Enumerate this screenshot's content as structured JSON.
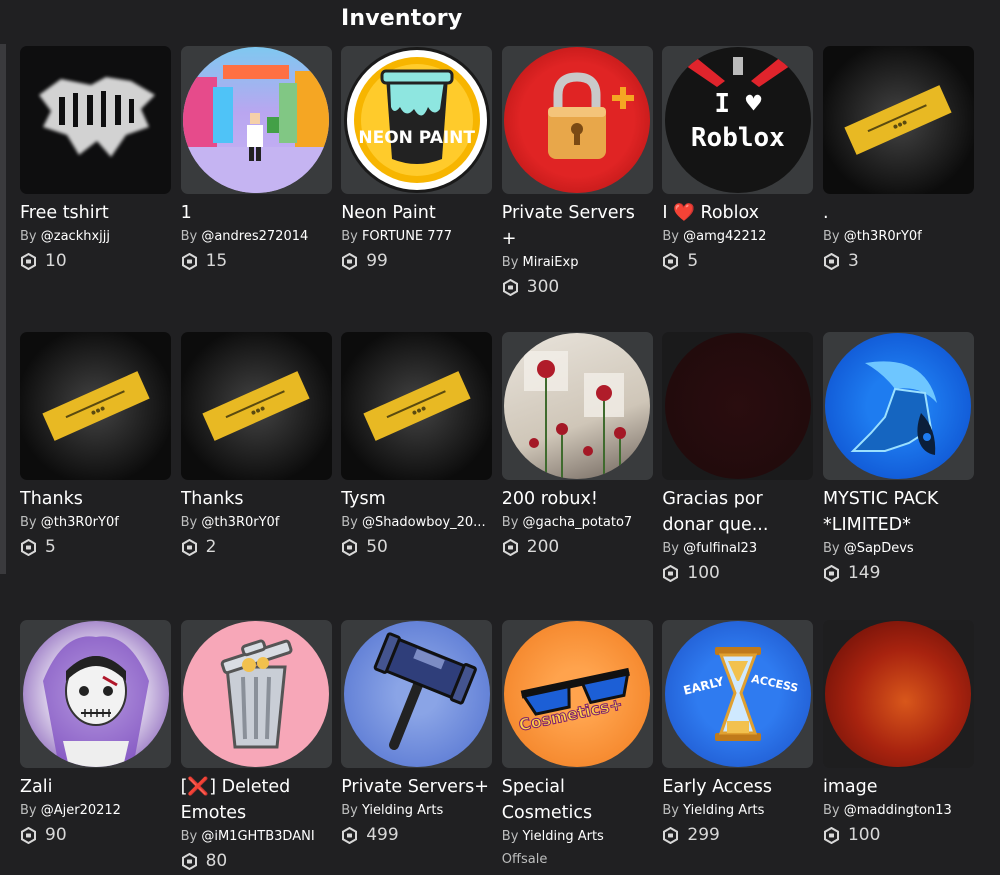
{
  "page": {
    "title": "Inventory"
  },
  "by_prefix": "By ",
  "items": [
    {
      "name": "Free tshirt",
      "creator": "@zackhxjjj",
      "price": "10"
    },
    {
      "name": "1",
      "creator": "@andres272014",
      "price": "15"
    },
    {
      "name": "Neon Paint",
      "creator": "FORTUNE 777",
      "price": "99",
      "thumb_text": "NEON PAINT"
    },
    {
      "name": "Private Servers +",
      "creator": "MiraiExp",
      "price": "300"
    },
    {
      "name": "I ❤️ Roblox",
      "creator": "@amg42212",
      "price": "5",
      "thumb_text_1": "I ♥",
      "thumb_text_2": "Roblox"
    },
    {
      "name": ".",
      "creator": "@th3R0rY0f",
      "price": "3"
    },
    {
      "name": "Thanks",
      "creator": "@th3R0rY0f",
      "price": "5"
    },
    {
      "name": "Thanks",
      "creator": "@th3R0rY0f",
      "price": "2"
    },
    {
      "name": "Tysm",
      "creator": "@Shadowboy_20...",
      "price": "50"
    },
    {
      "name": "200 robux!",
      "creator": "@gacha_potato7",
      "price": "200"
    },
    {
      "name": "Gracias por donar que...",
      "creator": "@fulfinal23",
      "price": "100"
    },
    {
      "name": "MYSTIC PACK *LIMITED*",
      "creator": "@SapDevs",
      "price": "149"
    },
    {
      "name": "Zali",
      "creator": "@Ajer20212",
      "price": "90"
    },
    {
      "name": "[❌] Deleted Emotes",
      "creator": "@iM1GHTB3DANI",
      "price": "80"
    },
    {
      "name": "Private Servers+",
      "creator": "Yielding Arts",
      "price": "499"
    },
    {
      "name": "Special Cosmetics",
      "creator": "Yielding Arts",
      "status": "Offsale",
      "thumb_text": "Cosmetics+"
    },
    {
      "name": "Early Access",
      "creator": "Yielding Arts",
      "price": "299",
      "thumb_text_1": "EARLY",
      "thumb_text_2": "ACCESS"
    },
    {
      "name": "image",
      "creator": "@maddington13",
      "price": "100"
    }
  ],
  "colors": {
    "background": "#202022",
    "card_background": "#393b3d",
    "text_primary": "#ffffff",
    "text_secondary": "#bdbebe",
    "gold_ticket": "#e8b923",
    "heart_red": "#e0242c"
  },
  "icons": {
    "currency": "robux-icon"
  }
}
